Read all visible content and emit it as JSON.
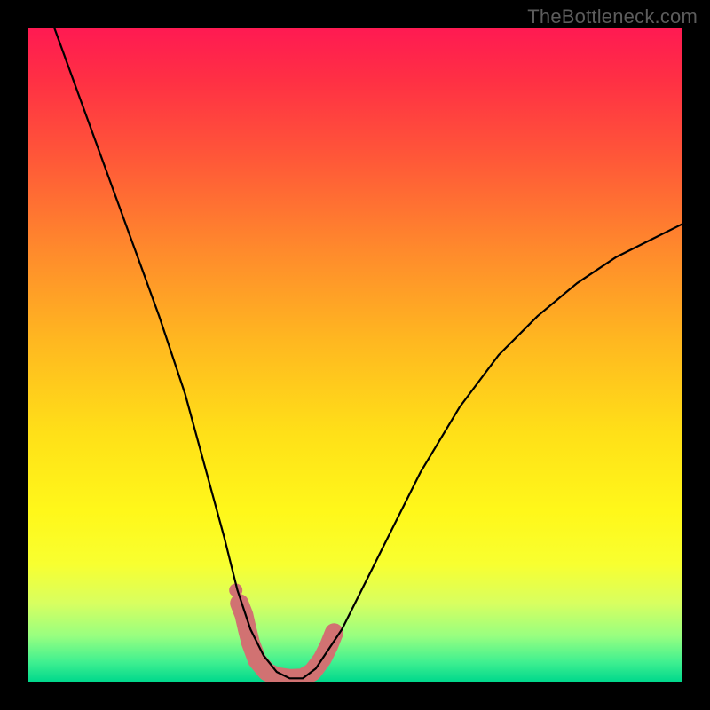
{
  "watermark": "TheBottleneck.com",
  "chart_data": {
    "type": "line",
    "title": "",
    "xlabel": "",
    "ylabel": "",
    "xlim": [
      0,
      100
    ],
    "ylim": [
      0,
      100
    ],
    "grid": false,
    "legend": false,
    "series": [
      {
        "name": "bottleneck-curve",
        "x": [
          4,
          8,
          12,
          16,
          20,
          24,
          27,
          30,
          32,
          34,
          36,
          38,
          40,
          42,
          44,
          48,
          54,
          60,
          66,
          72,
          78,
          84,
          90,
          96,
          100
        ],
        "y": [
          100,
          89,
          78,
          67,
          56,
          44,
          33,
          22,
          14,
          8,
          4,
          1.5,
          0.5,
          0.5,
          2,
          8,
          20,
          32,
          42,
          50,
          56,
          61,
          65,
          68,
          70
        ]
      }
    ],
    "highlight_band": {
      "name": "optimum-band",
      "color": "#d17272",
      "points": [
        {
          "x": 32.3,
          "y": 12.0
        },
        {
          "x": 33.0,
          "y": 10.2
        },
        {
          "x": 33.5,
          "y": 8.0
        },
        {
          "x": 34.0,
          "y": 6.0
        },
        {
          "x": 35.0,
          "y": 3.3
        },
        {
          "x": 36.5,
          "y": 1.5
        },
        {
          "x": 38.0,
          "y": 0.8
        },
        {
          "x": 40.0,
          "y": 0.5
        },
        {
          "x": 42.0,
          "y": 0.6
        },
        {
          "x": 43.5,
          "y": 1.5
        },
        {
          "x": 45.0,
          "y": 3.5
        },
        {
          "x": 46.0,
          "y": 5.5
        },
        {
          "x": 46.8,
          "y": 7.5
        }
      ]
    },
    "gradient_stops": [
      {
        "pos": 0.0,
        "color": "#ff1a52"
      },
      {
        "pos": 0.08,
        "color": "#ff3044"
      },
      {
        "pos": 0.2,
        "color": "#ff5838"
      },
      {
        "pos": 0.34,
        "color": "#ff8a2c"
      },
      {
        "pos": 0.48,
        "color": "#ffb820"
      },
      {
        "pos": 0.62,
        "color": "#ffe018"
      },
      {
        "pos": 0.74,
        "color": "#fff81a"
      },
      {
        "pos": 0.82,
        "color": "#f8ff30"
      },
      {
        "pos": 0.88,
        "color": "#d8ff60"
      },
      {
        "pos": 0.93,
        "color": "#98ff80"
      },
      {
        "pos": 0.97,
        "color": "#40f090"
      },
      {
        "pos": 1.0,
        "color": "#00d88c"
      }
    ]
  }
}
